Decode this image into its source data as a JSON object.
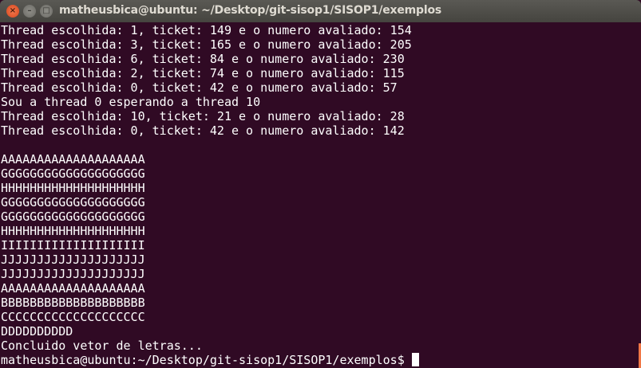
{
  "window": {
    "title": "matheusbica@ubuntu: ~/Desktop/git-sisop1/SISOP1/exemplos"
  },
  "terminal": {
    "lines": [
      "Thread escolhida: 1, ticket: 149 e o numero avaliado: 154",
      "Thread escolhida: 3, ticket: 165 e o numero avaliado: 205",
      "Thread escolhida: 6, ticket: 84 e o numero avaliado: 230",
      "Thread escolhida: 2, ticket: 74 e o numero avaliado: 115",
      "Thread escolhida: 0, ticket: 42 e o numero avaliado: 57",
      "Sou a thread 0 esperando a thread 10",
      "Thread escolhida: 10, ticket: 21 e o numero avaliado: 28",
      "Thread escolhida: 0, ticket: 42 e o numero avaliado: 142",
      "",
      "AAAAAAAAAAAAAAAAAAAA",
      "GGGGGGGGGGGGGGGGGGGG",
      "HHHHHHHHHHHHHHHHHHHH",
      "GGGGGGGGGGGGGGGGGGGG",
      "GGGGGGGGGGGGGGGGGGGG",
      "HHHHHHHHHHHHHHHHHHHH",
      "IIIIIIIIIIIIIIIIIIII",
      "JJJJJJJJJJJJJJJJJJJJ",
      "JJJJJJJJJJJJJJJJJJJJ",
      "AAAAAAAAAAAAAAAAAAAA",
      "BBBBBBBBBBBBBBBBBBBB",
      "CCCCCCCCCCCCCCCCCCCC",
      "DDDDDDDDDD",
      "Concluido vetor de letras..."
    ],
    "prompt": "matheusbica@ubuntu:~/Desktop/git-sisop1/SISOP1/exemplos$ "
  }
}
